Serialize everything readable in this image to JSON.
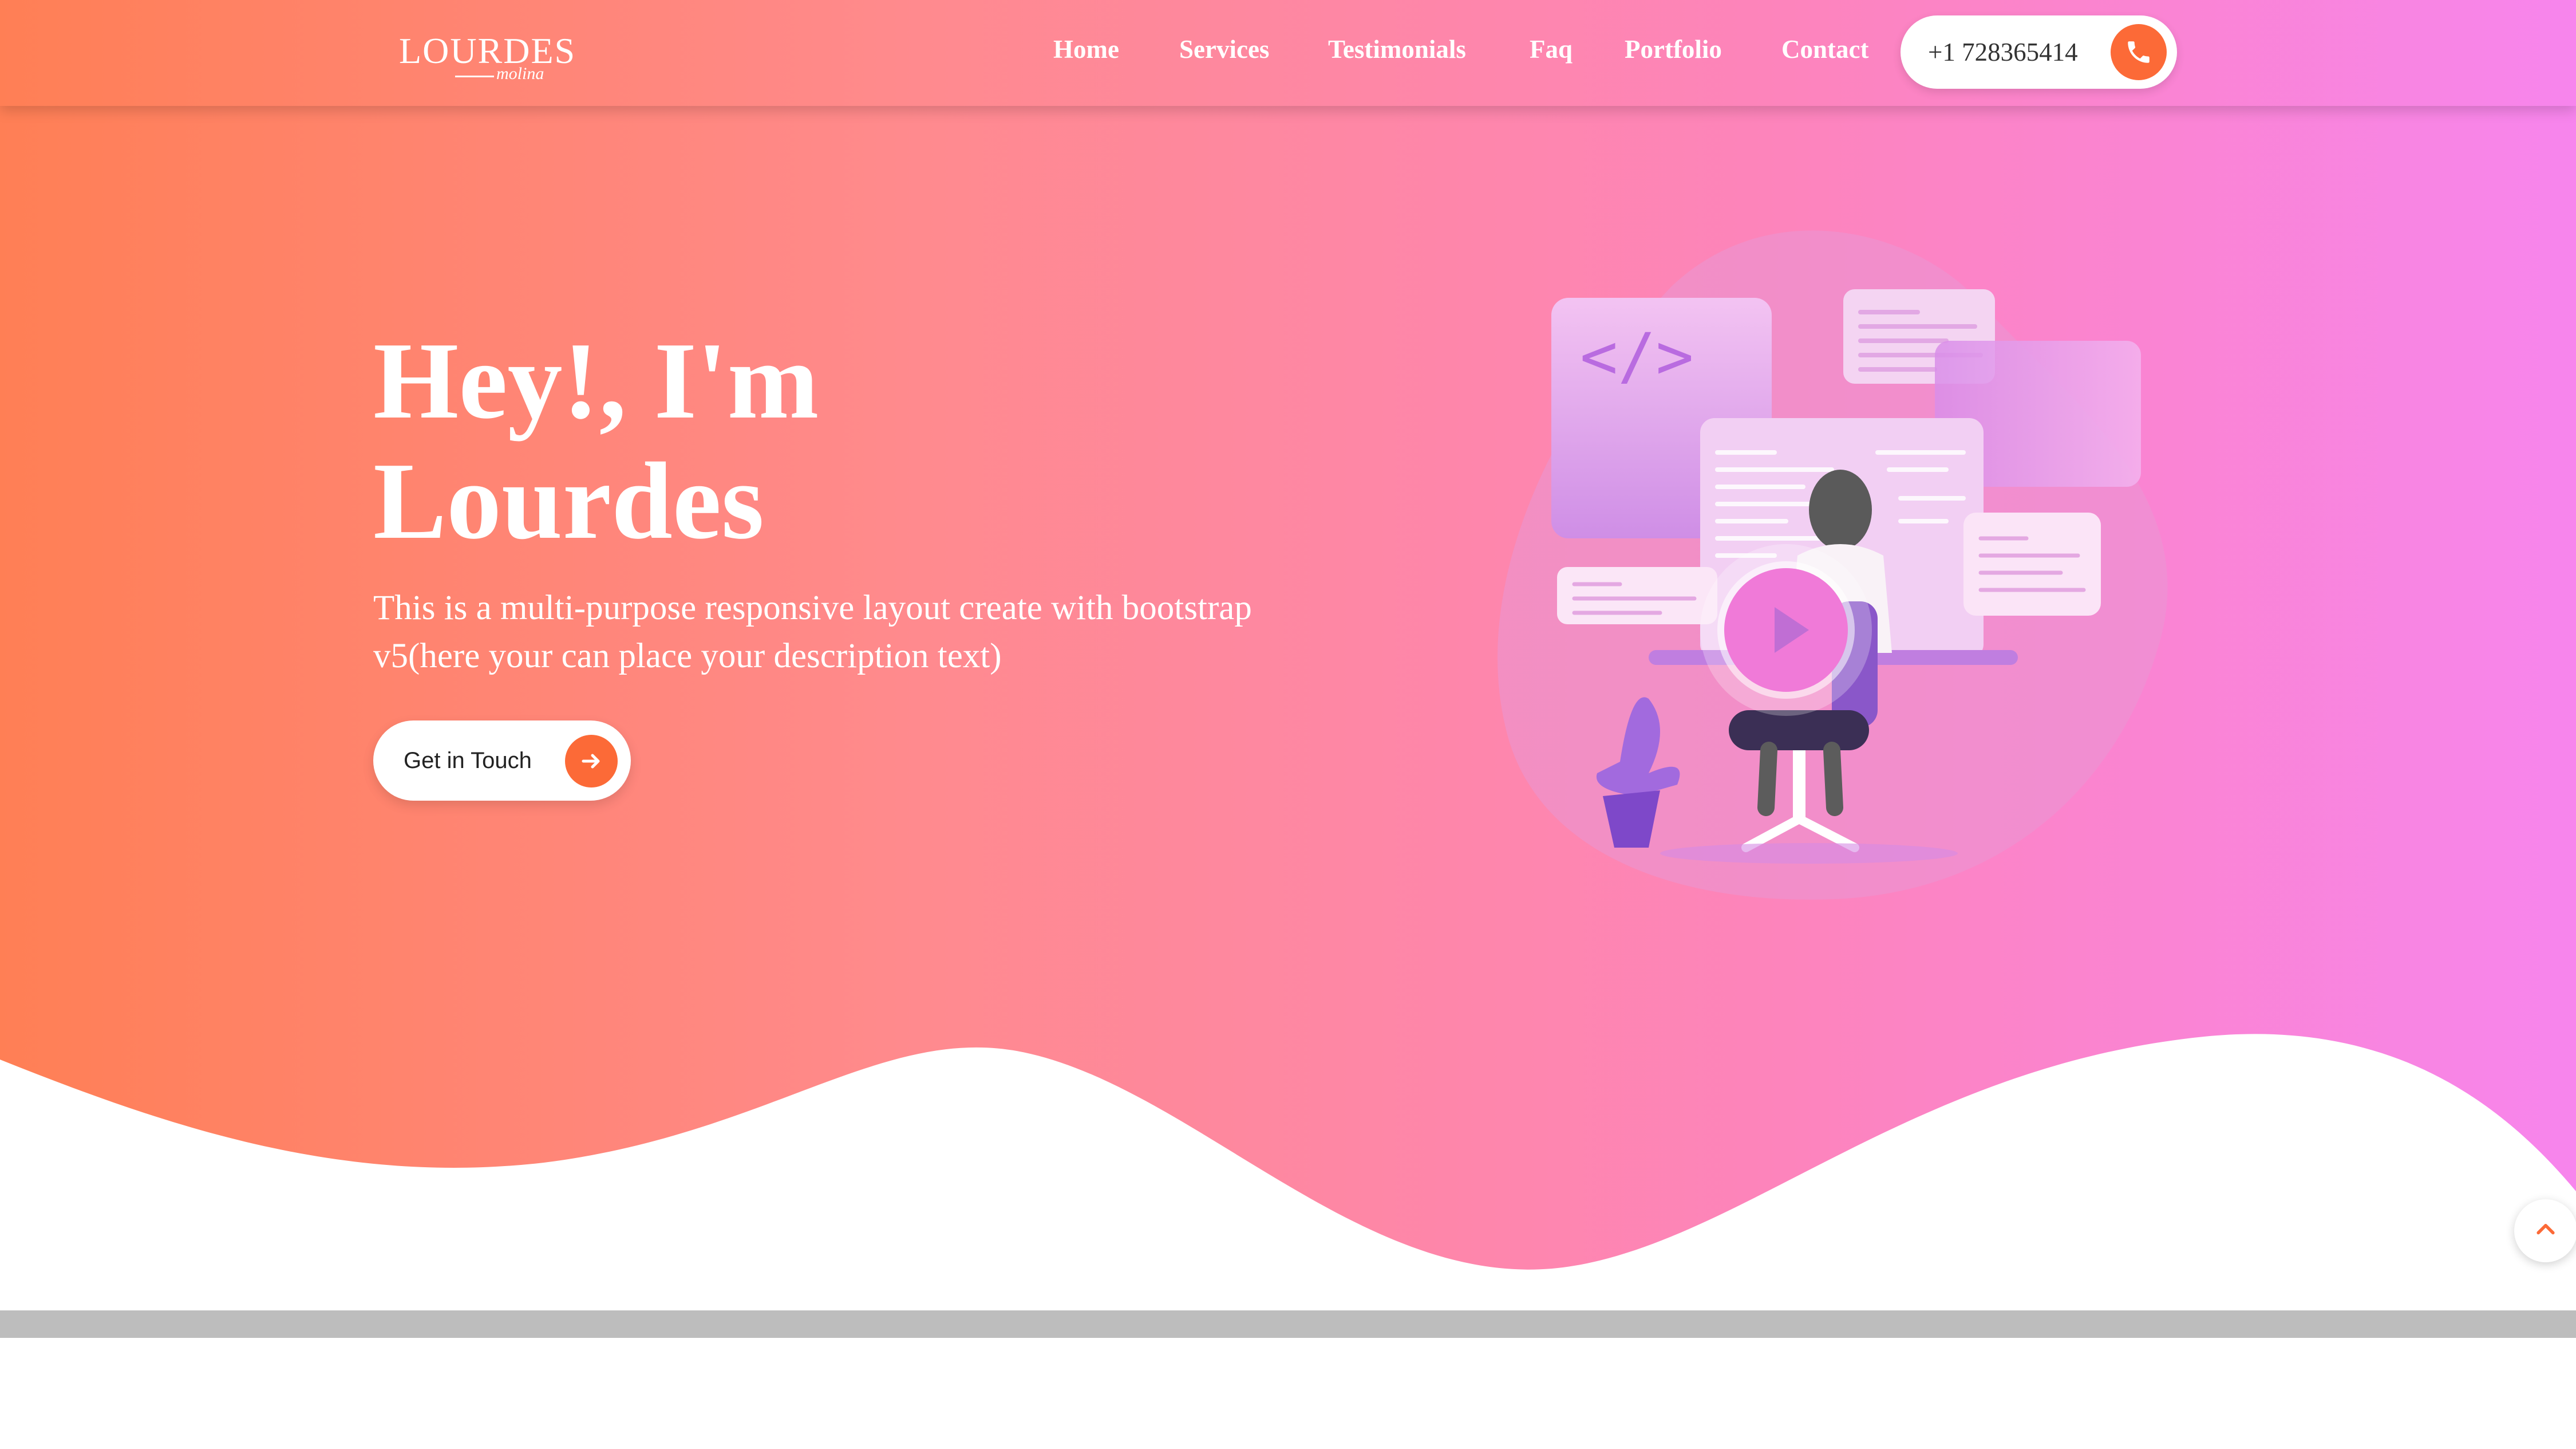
{
  "logo": {
    "main": "LOURDES",
    "script": "molina"
  },
  "nav": {
    "items": [
      "Home",
      "Services",
      "Testimonials",
      "Faq",
      "Portfolio",
      "Contact"
    ],
    "phone": "+1 728365414"
  },
  "hero": {
    "title_line1": "Hey!, I'm",
    "title_line2": "Lourdes",
    "description": "This is a multi-purpose responsive layout create with bootstrap v5(here your can place your description text)",
    "cta_label": "Get in Touch"
  },
  "icons": {
    "phone": "phone-icon",
    "cta_arrow": "arrow-right-icon",
    "play": "play-icon",
    "back_to_top": "chevron-up-icon"
  },
  "colors": {
    "gradient_start": "#ff7f55",
    "gradient_end": "#f785ed",
    "accent": "#fc6a37",
    "illustration_purple": "#c48ce8"
  }
}
